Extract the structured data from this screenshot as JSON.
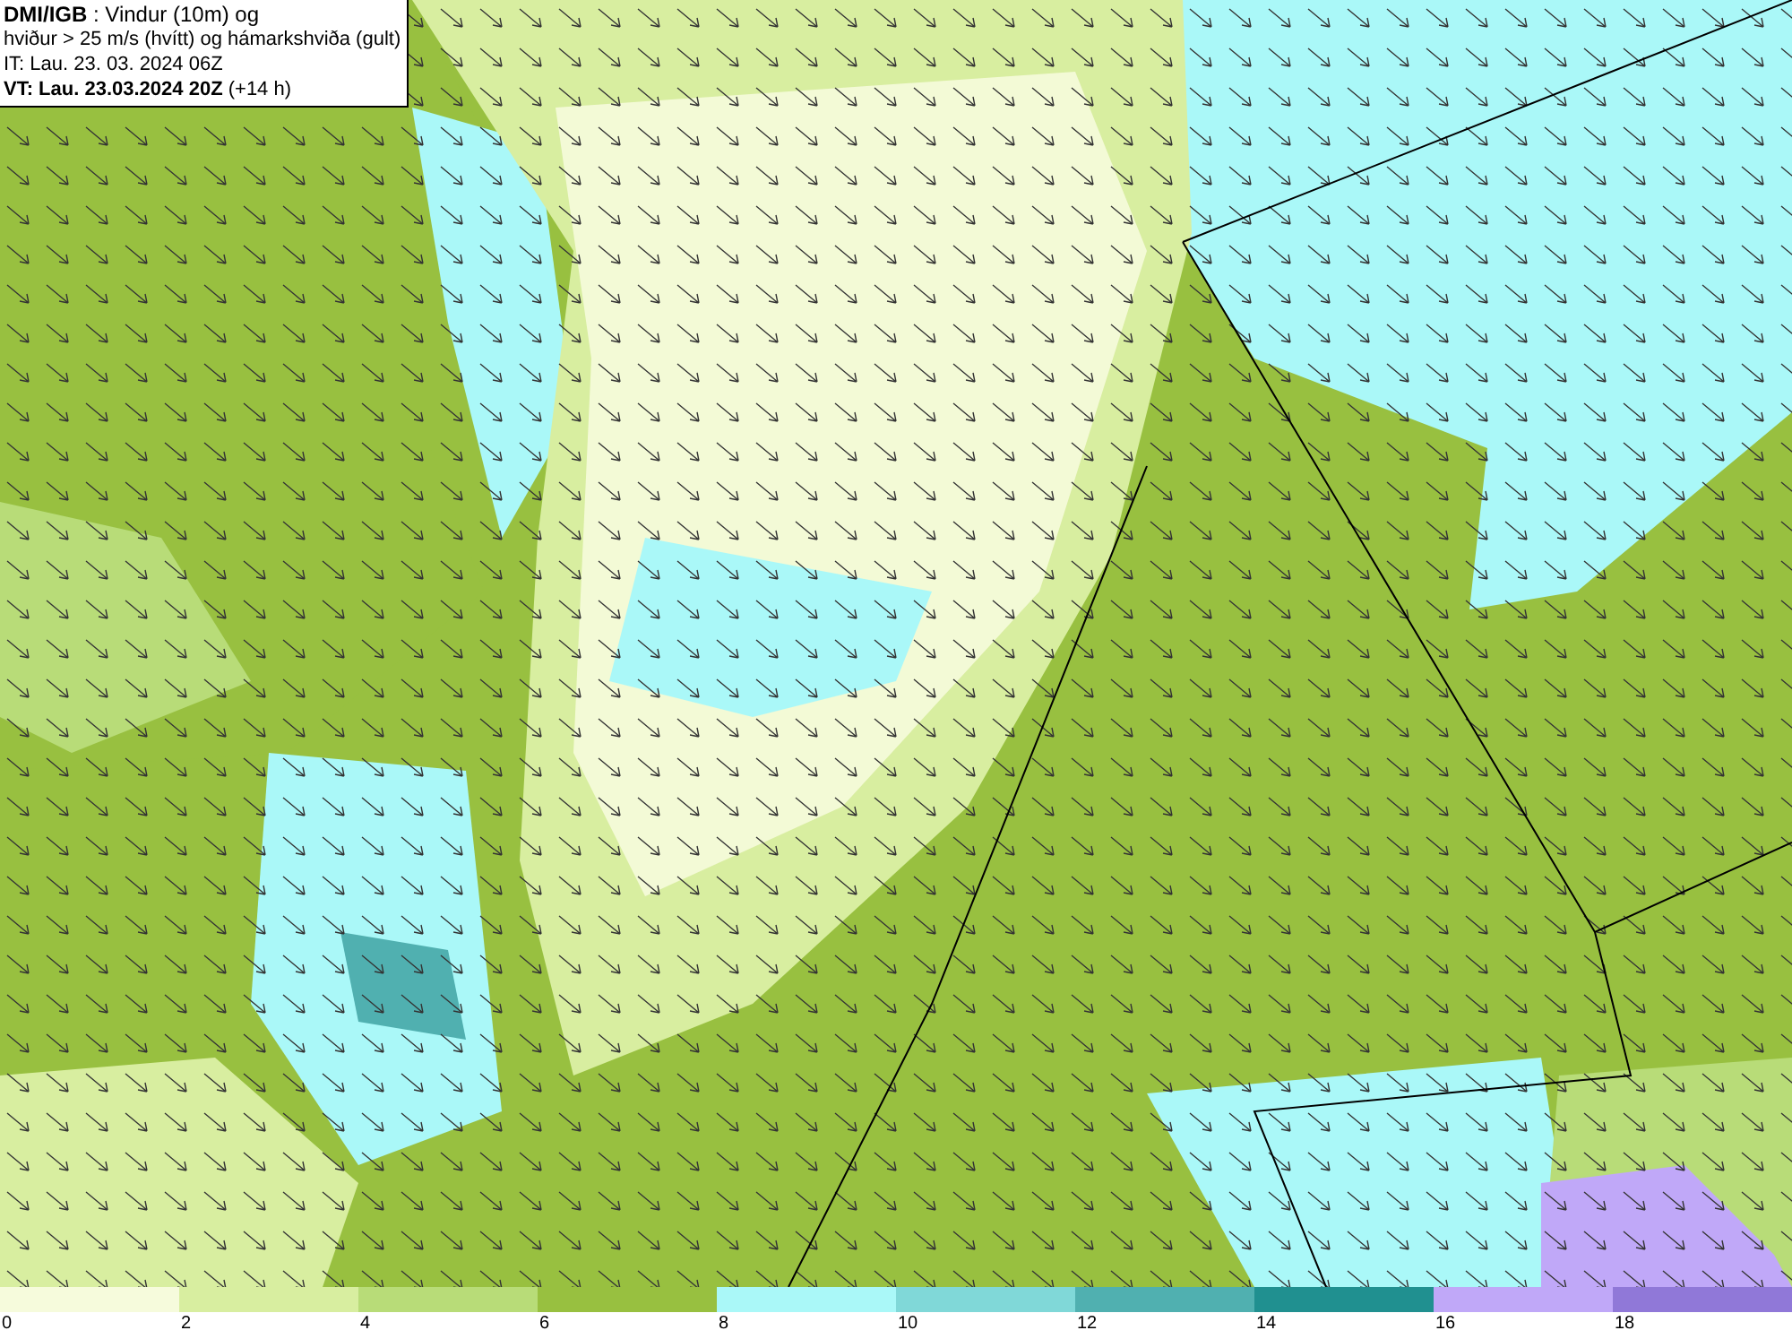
{
  "info_box": {
    "lines": [
      "**DMI/IGB** : Vindur (10m) og",
      "hviður > 25 m/s (hvítt) og hámarkshviða (gult)",
      "IT: Lau. 23. 03. 2024 06Z",
      "**VT: Lau. 23.03.2024 20Z** (+14 h)"
    ]
  },
  "legend": {
    "bins": [
      {
        "label": "0",
        "color": "#f6fbdc"
      },
      {
        "label": "2",
        "color": "#d8eea0"
      },
      {
        "label": "4",
        "color": "#b8dc78"
      },
      {
        "label": "6",
        "color": "#98c040"
      },
      {
        "label": "8",
        "color": "#aaf8f8"
      },
      {
        "label": "10",
        "color": "#80d8d8"
      },
      {
        "label": "12",
        "color": "#50b0b0"
      },
      {
        "label": "14",
        "color": "#209090"
      },
      {
        "label": "16",
        "color": "#c0a8f8"
      },
      {
        "label": "18",
        "color": "#9078d8"
      }
    ]
  }
}
